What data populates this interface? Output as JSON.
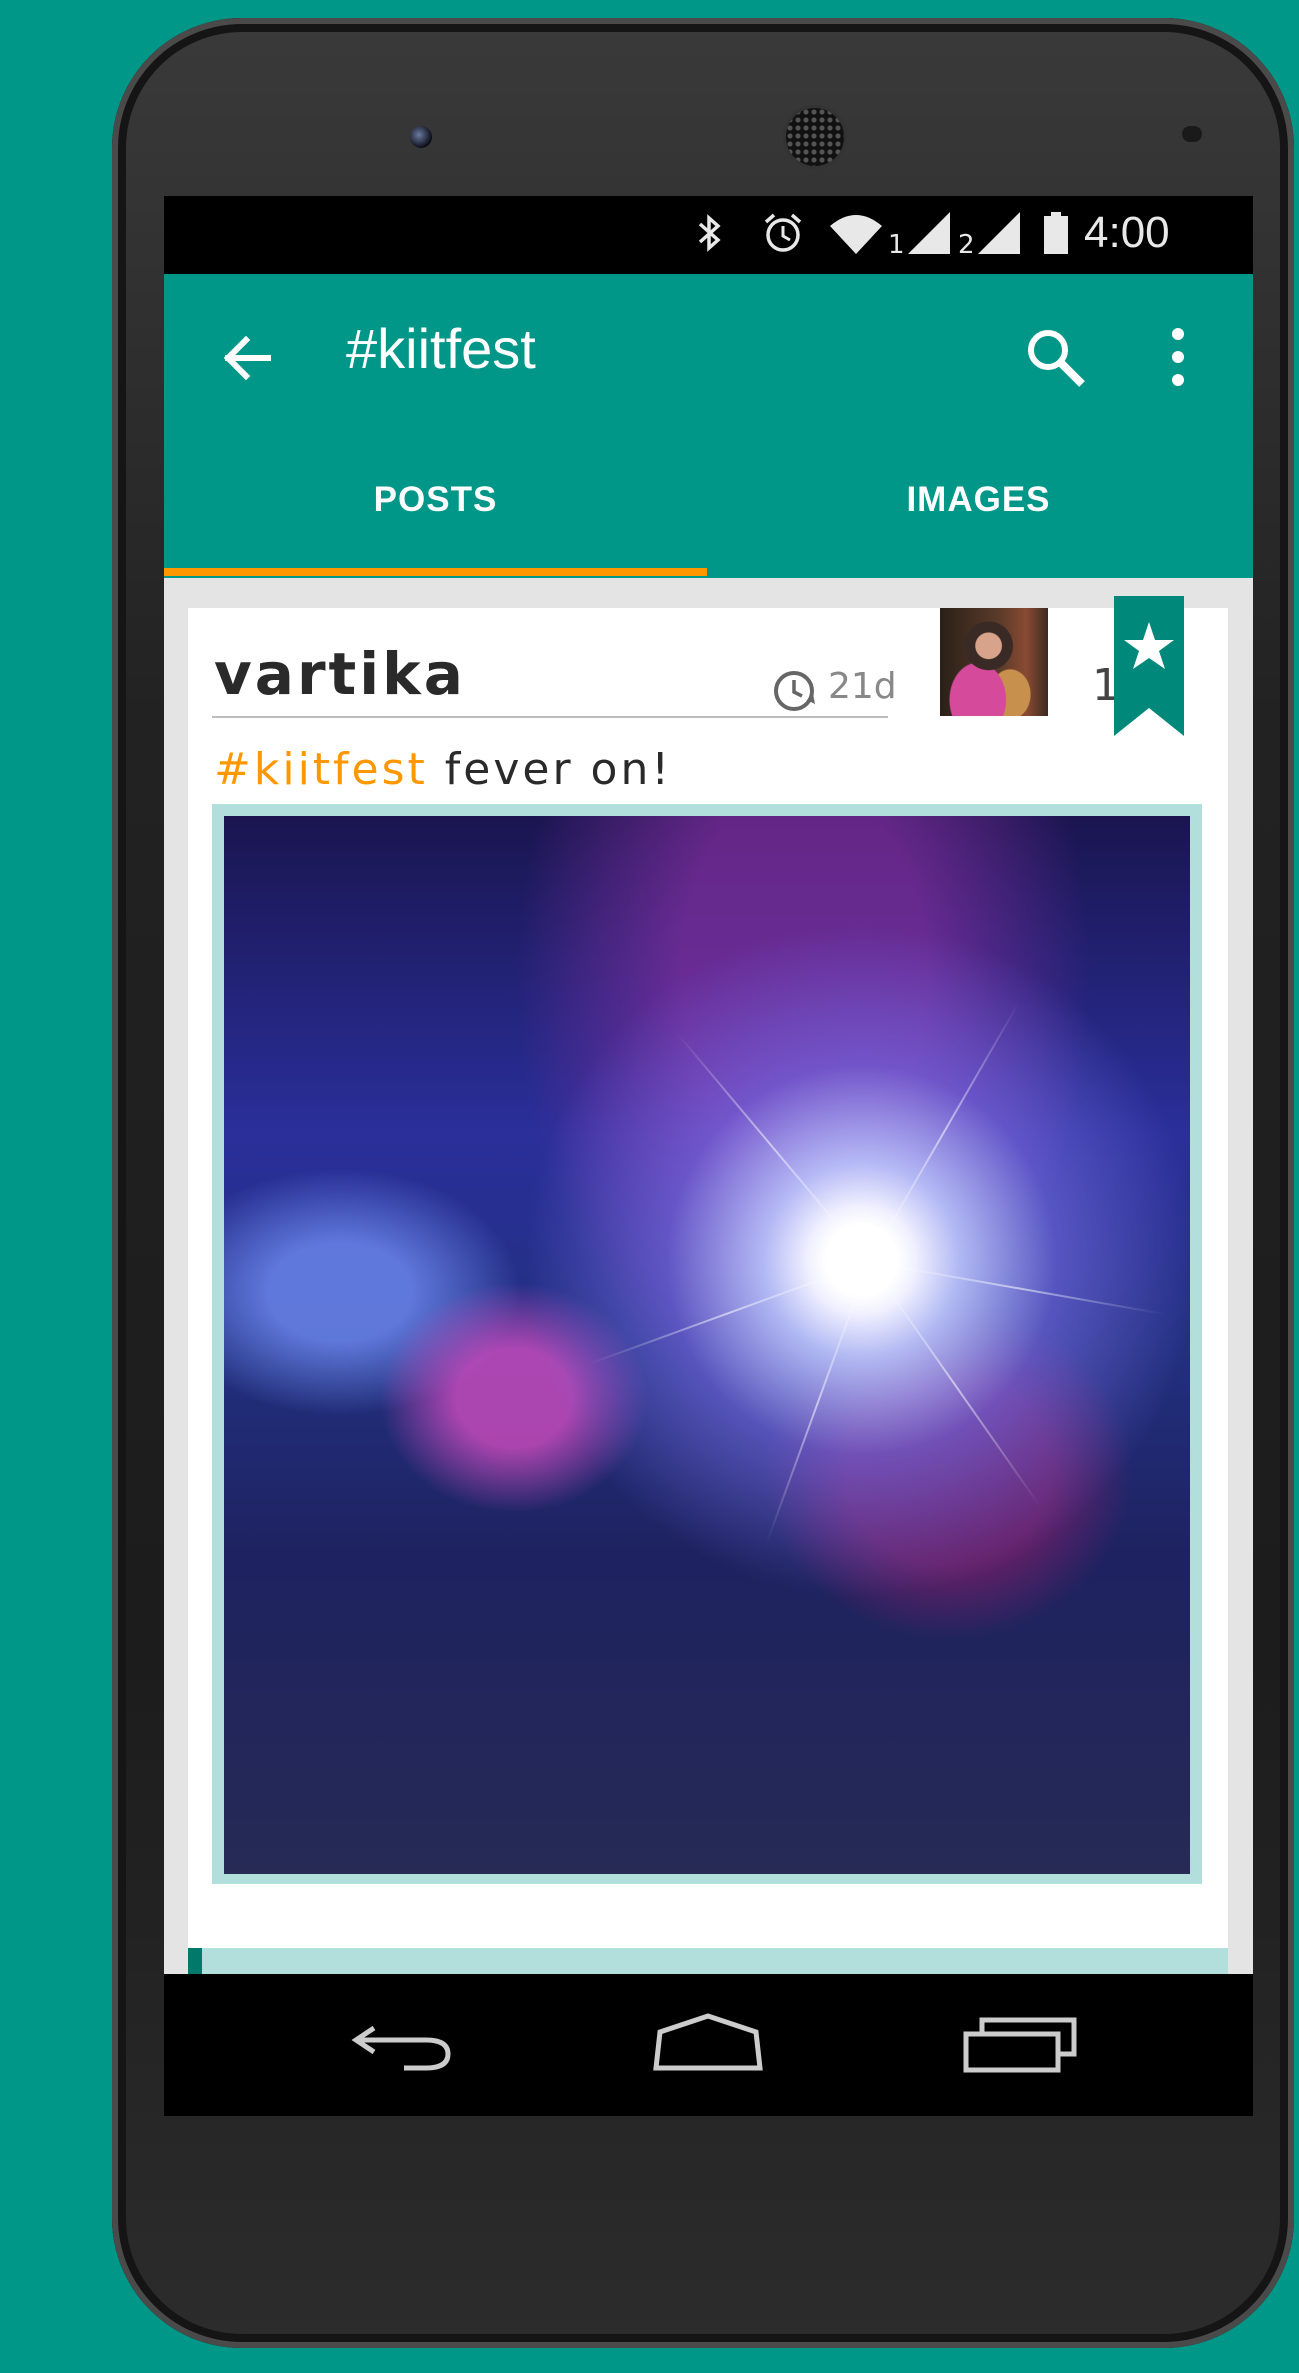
{
  "colors": {
    "primary": "#009688",
    "accent": "#ff9800",
    "card_accent": "#b2dfdb"
  },
  "status_bar": {
    "time": "4:00",
    "sim1": "1",
    "sim2": "2",
    "icons": [
      "bluetooth-icon",
      "alarm-icon",
      "wifi-icon",
      "signal-icon",
      "battery-icon"
    ]
  },
  "app_bar": {
    "title": "#kiitfest",
    "icons": [
      "back-arrow-icon",
      "search-icon",
      "more-vert-icon"
    ]
  },
  "tabs": [
    {
      "label": "POSTS",
      "selected": true
    },
    {
      "label": "IMAGES",
      "selected": false
    }
  ],
  "post": {
    "author": "vartika",
    "time_ago": "21d",
    "star_count": "1",
    "hashtag": "#kiitfest",
    "text": " fever on!"
  },
  "nav_bar": {
    "icons": [
      "back-icon",
      "home-icon",
      "recents-icon"
    ]
  }
}
